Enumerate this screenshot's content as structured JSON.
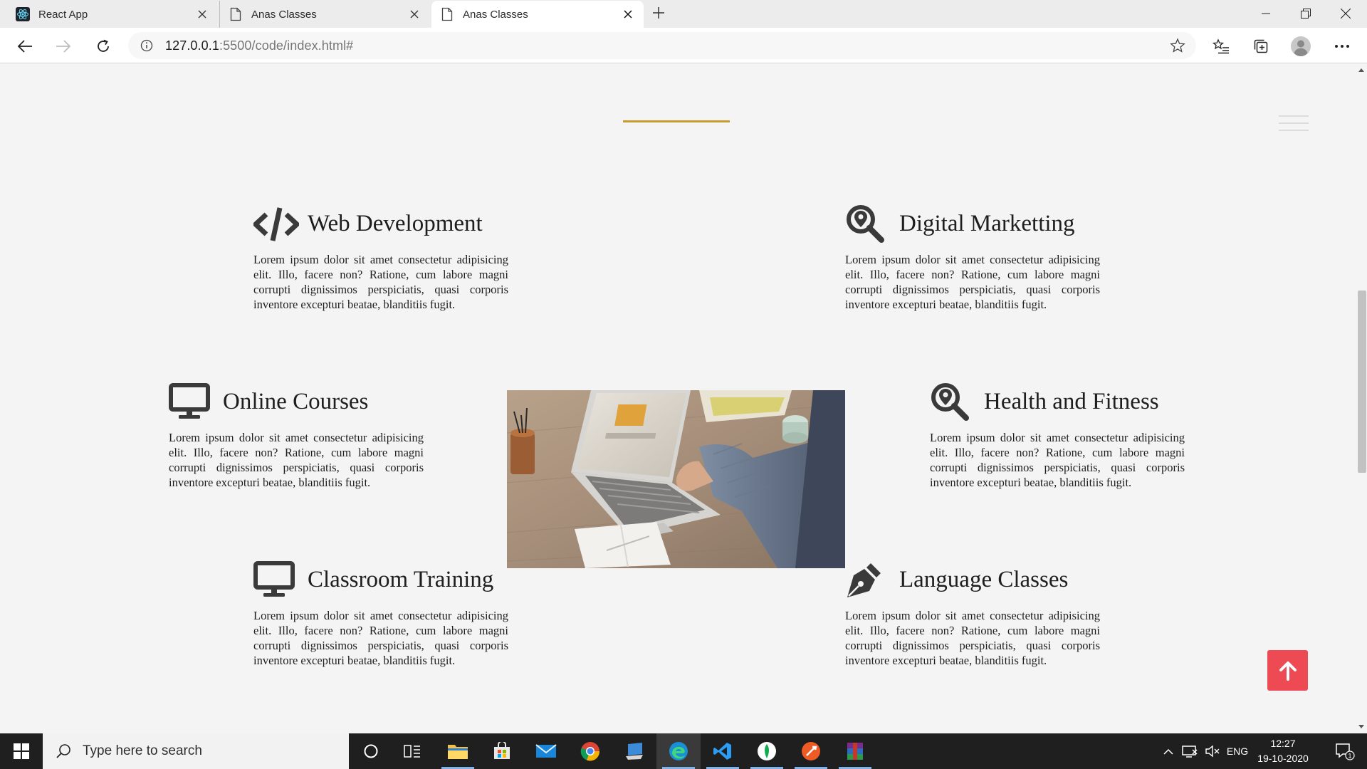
{
  "browser": {
    "tabs": [
      {
        "title": "React App",
        "icon": "react-icon",
        "active": false
      },
      {
        "title": "Anas Classes",
        "icon": "page-icon",
        "active": false
      },
      {
        "title": "Anas Classes",
        "icon": "page-icon",
        "active": true
      }
    ],
    "url_host": "127.0.0.1",
    "url_path": ":5500/code/index.html#"
  },
  "page": {
    "accent_color": "#c99a2e",
    "services": [
      {
        "title": "Web Development",
        "icon": "code-icon",
        "text": "Lorem ipsum dolor sit amet consectetur adipisicing elit. Illo, facere non? Ratione, cum labore magni corrupti dignissimos perspiciatis, quasi corporis inventore excepturi beatae, blanditiis fugit."
      },
      {
        "title": "Digital Marketting",
        "icon": "search-location-icon",
        "text": "Lorem ipsum dolor sit amet consectetur adipisicing elit. Illo, facere non? Ratione, cum labore magni corrupti dignissimos perspiciatis, quasi corporis inventore excepturi beatae, blanditiis fugit."
      },
      {
        "title": "Online Courses",
        "icon": "desktop-icon",
        "text": "Lorem ipsum dolor sit amet consectetur adipisicing elit. Illo, facere non? Ratione, cum labore magni corrupti dignissimos perspiciatis, quasi corporis inventore excepturi beatae, blanditiis fugit."
      },
      {
        "title": "Health and Fitness",
        "icon": "search-location-icon",
        "text": "Lorem ipsum dolor sit amet consectetur adipisicing elit. Illo, facere non? Ratione, cum labore magni corrupti dignissimos perspiciatis, quasi corporis inventore excepturi beatae, blanditiis fugit."
      },
      {
        "title": "Classroom Training",
        "icon": "desktop-icon",
        "text": "Lorem ipsum dolor sit amet consectetur adipisicing elit. Illo, facere non? Ratione, cum labore magni corrupti dignissimos perspiciatis, quasi corporis inventore excepturi beatae, blanditiis fugit."
      },
      {
        "title": "Language Classes",
        "icon": "pen-nib-icon",
        "text": "Lorem ipsum dolor sit amet consectetur adipisicing elit. Illo, facere non? Ratione, cum labore magni corrupti dignissimos perspiciatis, quasi corporis inventore excepturi beatae, blanditiis fugit."
      }
    ],
    "back_to_top_color": "#ee4a53"
  },
  "taskbar": {
    "search_placeholder": "Type here to search",
    "language": "ENG",
    "time": "12:27",
    "date": "19-10-2020",
    "notification_count": "1"
  }
}
